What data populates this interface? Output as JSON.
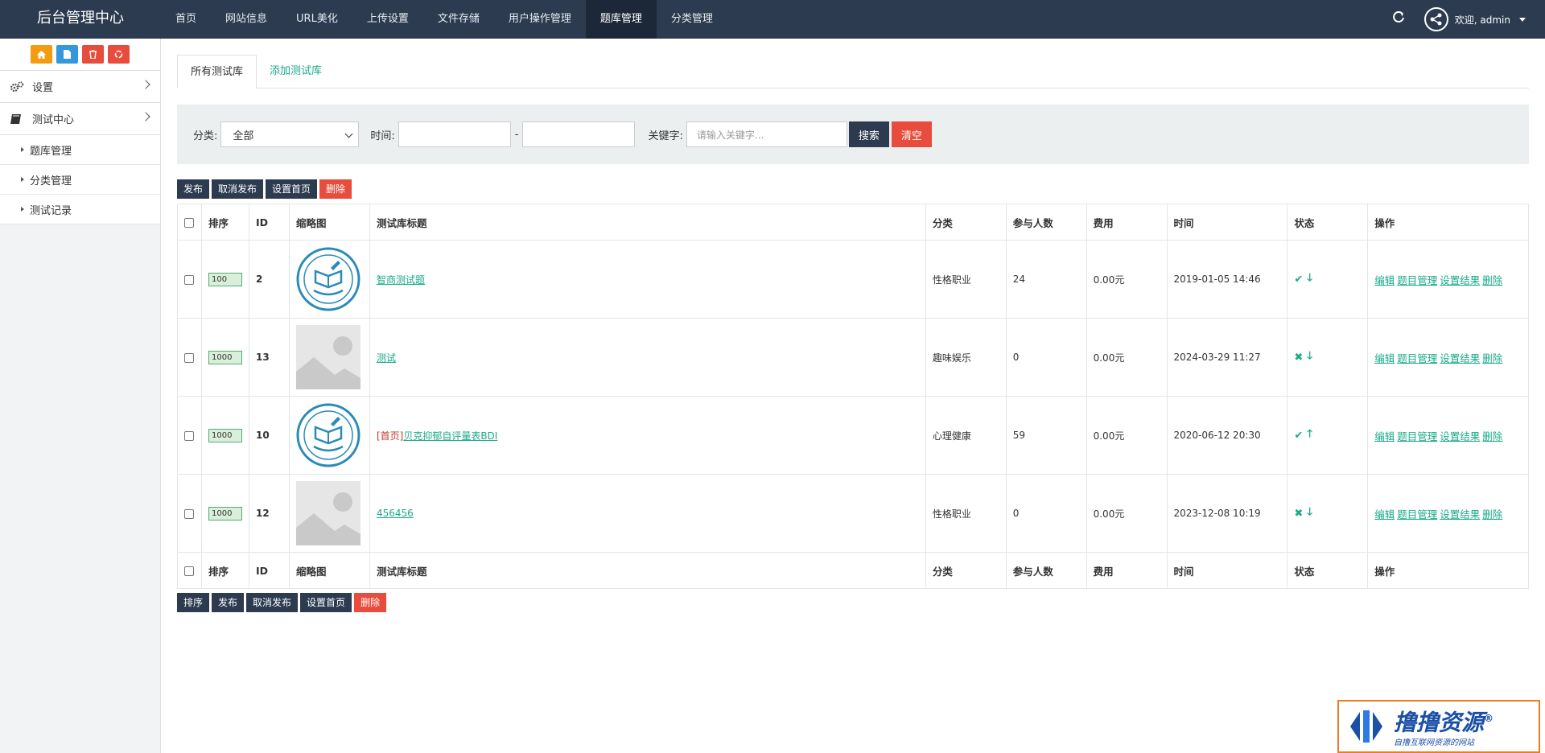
{
  "app": {
    "brand": "后台管理中心"
  },
  "nav": {
    "items": [
      "首页",
      "网站信息",
      "URL美化",
      "上传设置",
      "文件存储",
      "用户操作管理",
      "题库管理",
      "分类管理"
    ],
    "active_index": 6
  },
  "user": {
    "greeting": "欢迎, admin"
  },
  "colors": {
    "topbar": "#2c3b4f",
    "accent": "#1aaa8a",
    "danger": "#e74c3c",
    "quick": [
      "#f39c12",
      "#3498db",
      "#e74c3c",
      "#e74c3c"
    ]
  },
  "sidebar": {
    "quick_icons": [
      "home-icon",
      "file-icon",
      "trash-icon",
      "recycle-icon"
    ],
    "groups": [
      {
        "label": "设置",
        "icon": "gears-icon"
      },
      {
        "label": "测试中心",
        "icon": "book-icon"
      }
    ],
    "sub_items": [
      "题库管理",
      "分类管理",
      "测试记录"
    ]
  },
  "tabs": {
    "all": "所有测试库",
    "add": "添加测试库"
  },
  "filter": {
    "category_label": "分类:",
    "category_value": "全部",
    "time_label": "时间:",
    "time_sep": "-",
    "keyword_label": "关键字:",
    "keyword_placeholder": "请输入关键字...",
    "search_btn": "搜索",
    "clear_btn": "清空"
  },
  "actions_top": {
    "publish": "发布",
    "unpublish": "取消发布",
    "set_home": "设置首页",
    "delete": "删除"
  },
  "actions_bottom": {
    "sort": "排序",
    "publish": "发布",
    "unpublish": "取消发布",
    "set_home": "设置首页",
    "delete": "删除"
  },
  "table": {
    "headers": {
      "sort": "排序",
      "id": "ID",
      "thumb": "缩略图",
      "title": "测试库标题",
      "category": "分类",
      "participants": "参与人数",
      "fee": "费用",
      "time": "时间",
      "status": "状态",
      "ops": "操作"
    },
    "ops": {
      "edit": "编辑",
      "questions": "题目管理",
      "results": "设置结果",
      "delete": "删除"
    },
    "rows": [
      {
        "sort": "100",
        "id": "2",
        "thumb": "badge",
        "tag": "",
        "title": "智商测试题",
        "category": "性格职业",
        "participants": "24",
        "fee": "0.00元",
        "time": "2019-01-05 14:46",
        "published": true,
        "home": false
      },
      {
        "sort": "1000",
        "id": "13",
        "thumb": "placeholder",
        "tag": "",
        "title": "测试",
        "category": "趣味娱乐",
        "participants": "0",
        "fee": "0.00元",
        "time": "2024-03-29 11:27",
        "published": false,
        "home": false
      },
      {
        "sort": "1000",
        "id": "10",
        "thumb": "badge",
        "tag": "[首页]",
        "title": "贝克抑郁自评量表BDI",
        "category": "心理健康",
        "participants": "59",
        "fee": "0.00元",
        "time": "2020-06-12 20:30",
        "published": true,
        "home": true
      },
      {
        "sort": "1000",
        "id": "12",
        "thumb": "placeholder",
        "tag": "",
        "title": "456456",
        "category": "性格职业",
        "participants": "0",
        "fee": "0.00元",
        "time": "2023-12-08 10:19",
        "published": false,
        "home": false
      }
    ]
  },
  "watermark": {
    "line1": "撸撸资源",
    "line2": "自撸互联网资源的网站",
    "reg": "®"
  }
}
